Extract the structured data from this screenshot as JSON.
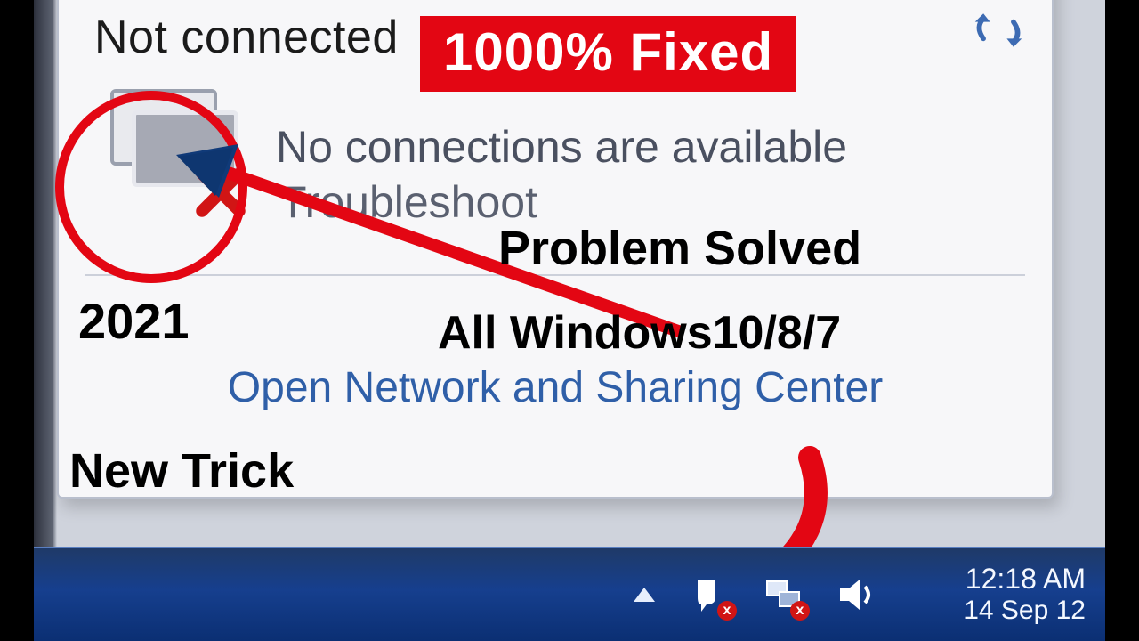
{
  "popup": {
    "title": "Not connected",
    "status": "No connections are available",
    "troubleshoot": "Troubleshoot",
    "open_link": "Open Network and Sharing Center"
  },
  "annotations": {
    "fixed": "1000% Fixed",
    "year": "2021",
    "solved": "Problem Solved",
    "windows": "All Windows10/8/7",
    "trick": "New Trick"
  },
  "taskbar": {
    "time": "12:18 AM",
    "date": "14 Sep 12",
    "action_center_badge": "x",
    "network_badge": "x"
  },
  "colors": {
    "accent_red": "#e30613",
    "link_blue": "#2f5fa8",
    "taskbar": "#163f8e"
  }
}
